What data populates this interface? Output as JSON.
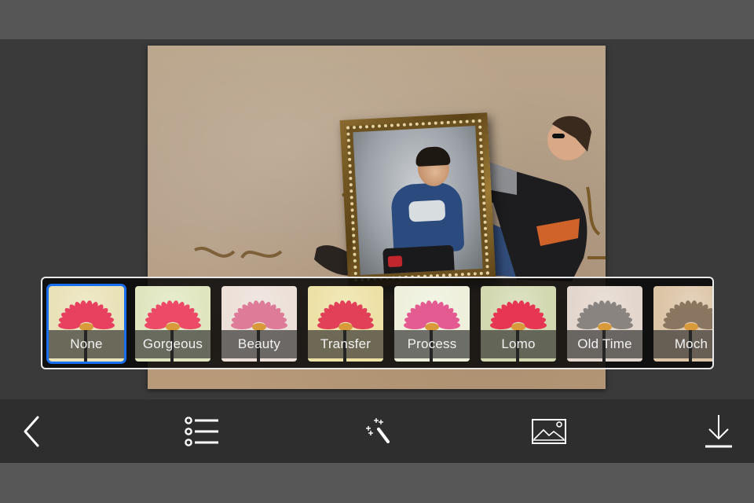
{
  "editor": {
    "canvas": {
      "frame_photo_subject": "child-in-blue-sweater",
      "main_photo_subject": "man-driving-imaginary-car"
    },
    "filters": {
      "selected_index": 0,
      "items": [
        {
          "label": "None",
          "tint": "#e9e2b8",
          "petal": "#e8405f"
        },
        {
          "label": "Gorgeous",
          "tint": "#dfe6bf",
          "petal": "#ec4a66"
        },
        {
          "label": "Beauty",
          "tint": "#ece0d8",
          "petal": "#dd7b98"
        },
        {
          "label": "Transfer",
          "tint": "#ede1a6",
          "petal": "#e23f58"
        },
        {
          "label": "Process",
          "tint": "#eef0dc",
          "petal": "#e45b92"
        },
        {
          "label": "Lomo",
          "tint": "#d2d8b0",
          "petal": "#e63654"
        },
        {
          "label": "Old Time",
          "tint": "#e3d6cc",
          "petal": "#8a8480"
        },
        {
          "label": "Moch",
          "tint": "#dcc4a6",
          "petal": "#8a7660"
        }
      ]
    }
  },
  "toolbar": {
    "items": [
      {
        "name": "back",
        "icon": "chevron-left-icon"
      },
      {
        "name": "frames-list",
        "icon": "list-icon"
      },
      {
        "name": "effects",
        "icon": "magic-wand-icon"
      },
      {
        "name": "gallery",
        "icon": "image-icon"
      },
      {
        "name": "save",
        "icon": "download-icon"
      }
    ]
  }
}
